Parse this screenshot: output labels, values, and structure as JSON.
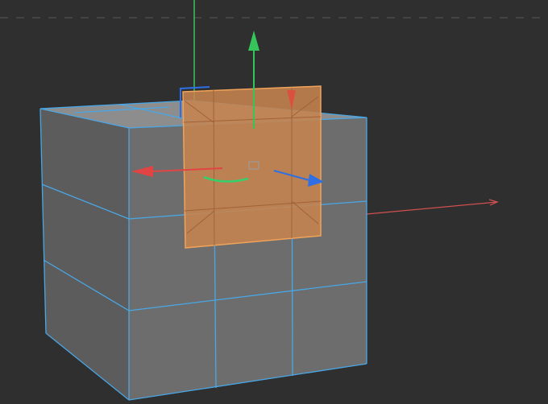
{
  "viewport": {
    "background_color": "#2f2f2f",
    "grid_line_color": "#4a4a4a"
  },
  "scene": {
    "cube_color_front": "#6e6e6e",
    "cube_color_side": "#5f5f5f",
    "cube_color_top": "#8d8d8d",
    "edge_color": "#49a7e6",
    "selection_fill": "#c7844f",
    "selection_edge": "#f0a35a"
  },
  "gizmo": {
    "x_axis_color": "#e24444",
    "y_axis_color": "#36c55a",
    "z_axis_color": "#2f6fe6",
    "rotation_color": "#34d06b"
  },
  "icons": {
    "move_gizmo": "move-gizmo-icon",
    "pivot": "pivot-square-icon",
    "corner": "view-corner-bracket-icon"
  }
}
